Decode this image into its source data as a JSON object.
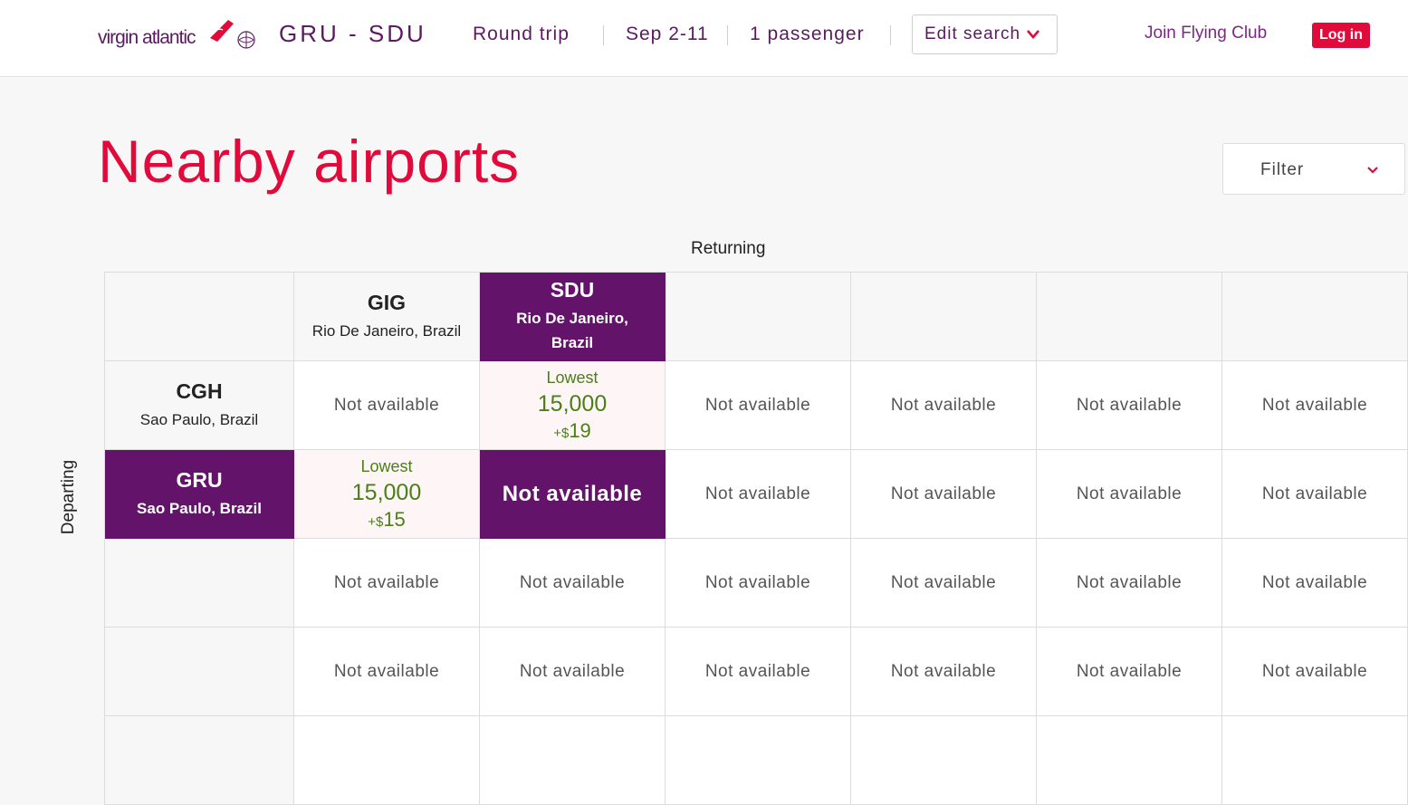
{
  "header": {
    "logo_text": "virgin atlantic",
    "route": "GRU - SDU",
    "trip_type": "Round trip",
    "dates": "Sep 2-11",
    "passengers": "1 passenger",
    "edit_search": "Edit search",
    "join": "Join Flying Club",
    "login": "Log in"
  },
  "page": {
    "title": "Nearby airports",
    "filter": "Filter",
    "returning": "Returning",
    "departing": "Departing"
  },
  "columns": [
    {
      "code": "GIG",
      "city": "Rio De Janeiro, Brazil"
    },
    {
      "code": "SDU",
      "city": "Rio De Janeiro, Brazil"
    },
    {
      "code": "",
      "city": ""
    },
    {
      "code": "",
      "city": ""
    },
    {
      "code": "",
      "city": ""
    },
    {
      "code": "",
      "city": ""
    }
  ],
  "rows": [
    {
      "code": "CGH",
      "city": "Sao Paulo, Brazil",
      "cells": [
        {
          "status": "Not available"
        },
        {
          "lowest": "Lowest",
          "miles": "15,000",
          "fee_prefix": "+$",
          "fee": "19"
        },
        {
          "status": "Not available"
        },
        {
          "status": "Not available"
        },
        {
          "status": "Not available"
        },
        {
          "status": "Not available"
        }
      ]
    },
    {
      "code": "GRU",
      "city": "Sao Paulo, Brazil",
      "cells": [
        {
          "lowest": "Lowest",
          "miles": "15,000",
          "fee_prefix": "+$",
          "fee": "15"
        },
        {
          "status": "Not available"
        },
        {
          "status": "Not available"
        },
        {
          "status": "Not available"
        },
        {
          "status": "Not available"
        },
        {
          "status": "Not available"
        }
      ]
    },
    {
      "code": "",
      "city": "",
      "cells": [
        {
          "status": "Not available"
        },
        {
          "status": "Not available"
        },
        {
          "status": "Not available"
        },
        {
          "status": "Not available"
        },
        {
          "status": "Not available"
        },
        {
          "status": "Not available"
        }
      ]
    },
    {
      "code": "",
      "city": "",
      "cells": [
        {
          "status": "Not available"
        },
        {
          "status": "Not available"
        },
        {
          "status": "Not available"
        },
        {
          "status": "Not available"
        },
        {
          "status": "Not available"
        },
        {
          "status": "Not available"
        }
      ]
    }
  ],
  "colors": {
    "brand_purple": "#63136a",
    "brand_red": "#e10a3b",
    "price_green": "#4b7f18"
  }
}
